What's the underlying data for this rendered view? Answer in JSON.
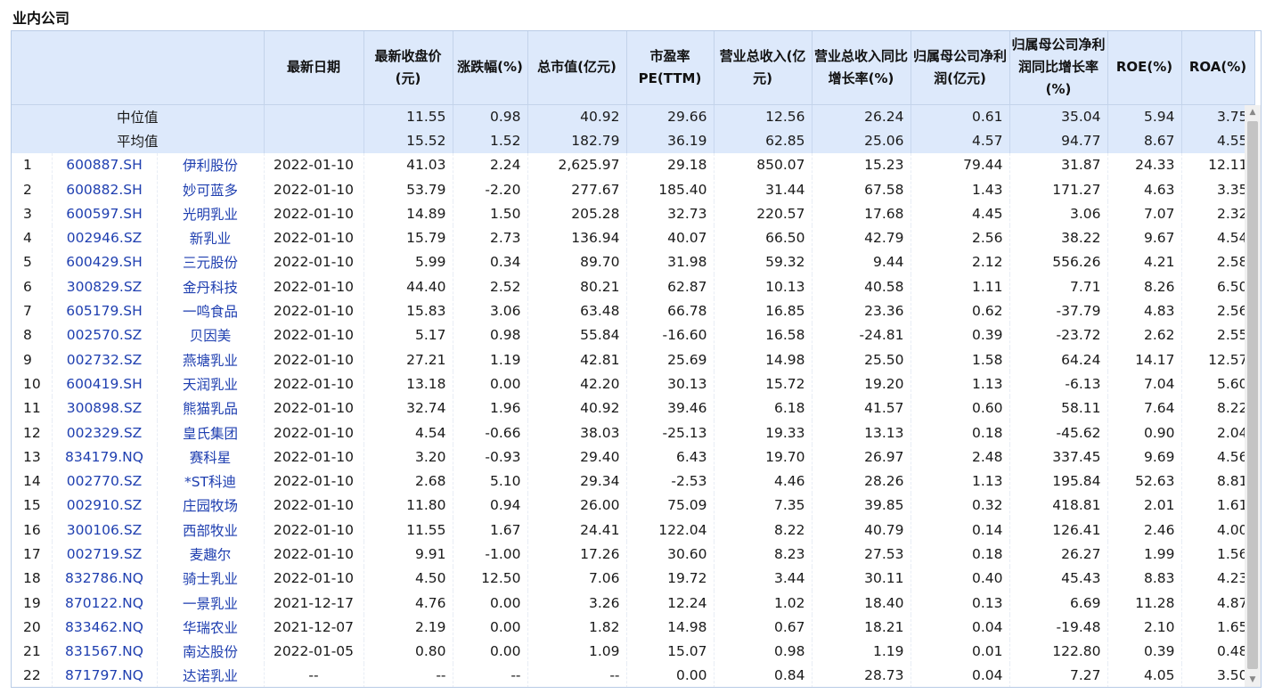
{
  "section_title": "业内公司",
  "headers": [
    "最新日期",
    "最新收盘价(元)",
    "涨跌幅(%)",
    "总市值(亿元)",
    "市盈率PE(TTM)",
    "营业总收入(亿元)",
    "营业总收入同比增长率(%)",
    "归属母公司净利润(亿元)",
    "归属母公司净利润同比增长率(%)",
    "ROE(%)",
    "ROA(%)"
  ],
  "stats": [
    {
      "label": "中位值",
      "values": [
        "11.55",
        "0.98",
        "40.92",
        "29.66",
        "12.56",
        "26.24",
        "0.61",
        "35.04",
        "5.94",
        "3.75"
      ]
    },
    {
      "label": "平均值",
      "values": [
        "15.52",
        "1.52",
        "182.79",
        "36.19",
        "62.85",
        "25.06",
        "4.57",
        "94.77",
        "8.67",
        "4.55"
      ]
    }
  ],
  "rows": [
    [
      "1",
      "600887.SH",
      "伊利股份",
      "2022-01-10",
      "41.03",
      "2.24",
      "2,625.97",
      "29.18",
      "850.07",
      "15.23",
      "79.44",
      "31.87",
      "24.33",
      "12.11"
    ],
    [
      "2",
      "600882.SH",
      "妙可蓝多",
      "2022-01-10",
      "53.79",
      "-2.20",
      "277.67",
      "185.40",
      "31.44",
      "67.58",
      "1.43",
      "171.27",
      "4.63",
      "3.35"
    ],
    [
      "3",
      "600597.SH",
      "光明乳业",
      "2022-01-10",
      "14.89",
      "1.50",
      "205.28",
      "32.73",
      "220.57",
      "17.68",
      "4.45",
      "3.06",
      "7.07",
      "2.32"
    ],
    [
      "4",
      "002946.SZ",
      "新乳业",
      "2022-01-10",
      "15.79",
      "2.73",
      "136.94",
      "40.07",
      "66.50",
      "42.79",
      "2.56",
      "38.22",
      "9.67",
      "4.54"
    ],
    [
      "5",
      "600429.SH",
      "三元股份",
      "2022-01-10",
      "5.99",
      "0.34",
      "89.70",
      "31.98",
      "59.32",
      "9.44",
      "2.12",
      "556.26",
      "4.21",
      "2.58"
    ],
    [
      "6",
      "300829.SZ",
      "金丹科技",
      "2022-01-10",
      "44.40",
      "2.52",
      "80.21",
      "62.87",
      "10.13",
      "40.58",
      "1.11",
      "7.71",
      "8.26",
      "6.50"
    ],
    [
      "7",
      "605179.SH",
      "一鸣食品",
      "2022-01-10",
      "15.83",
      "3.06",
      "63.48",
      "66.78",
      "16.85",
      "23.36",
      "0.62",
      "-37.79",
      "4.83",
      "2.56"
    ],
    [
      "8",
      "002570.SZ",
      "贝因美",
      "2022-01-10",
      "5.17",
      "0.98",
      "55.84",
      "-16.60",
      "16.58",
      "-24.81",
      "0.39",
      "-23.72",
      "2.62",
      "2.55"
    ],
    [
      "9",
      "002732.SZ",
      "燕塘乳业",
      "2022-01-10",
      "27.21",
      "1.19",
      "42.81",
      "25.69",
      "14.98",
      "25.50",
      "1.58",
      "64.24",
      "14.17",
      "12.57"
    ],
    [
      "10",
      "600419.SH",
      "天润乳业",
      "2022-01-10",
      "13.18",
      "0.00",
      "42.20",
      "30.13",
      "15.72",
      "19.20",
      "1.13",
      "-6.13",
      "7.04",
      "5.60"
    ],
    [
      "11",
      "300898.SZ",
      "熊猫乳品",
      "2022-01-10",
      "32.74",
      "1.96",
      "40.92",
      "39.46",
      "6.18",
      "41.57",
      "0.60",
      "58.11",
      "7.64",
      "8.22"
    ],
    [
      "12",
      "002329.SZ",
      "皇氏集团",
      "2022-01-10",
      "4.54",
      "-0.66",
      "38.03",
      "-25.13",
      "19.33",
      "13.13",
      "0.18",
      "-45.62",
      "0.90",
      "2.04"
    ],
    [
      "13",
      "834179.NQ",
      "赛科星",
      "2022-01-10",
      "3.20",
      "-0.93",
      "29.40",
      "6.43",
      "19.70",
      "26.97",
      "2.48",
      "337.45",
      "9.69",
      "4.56"
    ],
    [
      "14",
      "002770.SZ",
      "*ST科迪",
      "2022-01-10",
      "2.68",
      "5.10",
      "29.34",
      "-2.53",
      "4.46",
      "28.26",
      "1.13",
      "195.84",
      "52.63",
      "8.81"
    ],
    [
      "15",
      "002910.SZ",
      "庄园牧场",
      "2022-01-10",
      "11.80",
      "0.94",
      "26.00",
      "75.09",
      "7.35",
      "39.85",
      "0.32",
      "418.81",
      "2.01",
      "1.61"
    ],
    [
      "16",
      "300106.SZ",
      "西部牧业",
      "2022-01-10",
      "11.55",
      "1.67",
      "24.41",
      "122.04",
      "8.22",
      "40.79",
      "0.14",
      "126.41",
      "2.46",
      "4.00"
    ],
    [
      "17",
      "002719.SZ",
      "麦趣尔",
      "2022-01-10",
      "9.91",
      "-1.00",
      "17.26",
      "30.60",
      "8.23",
      "27.53",
      "0.18",
      "26.27",
      "1.99",
      "1.56"
    ],
    [
      "18",
      "832786.NQ",
      "骑士乳业",
      "2022-01-10",
      "4.50",
      "12.50",
      "7.06",
      "19.72",
      "3.44",
      "30.11",
      "0.40",
      "45.43",
      "8.83",
      "4.23"
    ],
    [
      "19",
      "870122.NQ",
      "一景乳业",
      "2021-12-17",
      "4.76",
      "0.00",
      "3.26",
      "12.24",
      "1.02",
      "18.40",
      "0.13",
      "6.69",
      "11.28",
      "4.87"
    ],
    [
      "20",
      "833462.NQ",
      "华瑞农业",
      "2021-12-07",
      "2.19",
      "0.00",
      "1.82",
      "14.98",
      "0.67",
      "18.21",
      "0.04",
      "-19.48",
      "2.10",
      "1.65"
    ],
    [
      "21",
      "831567.NQ",
      "南达股份",
      "2022-01-05",
      "0.80",
      "0.00",
      "1.09",
      "15.07",
      "0.98",
      "1.19",
      "0.01",
      "122.80",
      "0.39",
      "0.48"
    ],
    [
      "22",
      "871797.NQ",
      "达诺乳业",
      "--",
      "--",
      "--",
      "--",
      "0.00",
      "0.84",
      "28.73",
      "0.04",
      "7.27",
      "4.05",
      "3.50"
    ]
  ],
  "scrollbar": {
    "up_icon": "triangle-up-icon",
    "down_icon": "triangle-down-icon"
  },
  "colors": {
    "header_bg": "#dde9fb",
    "link": "#1f3fb0",
    "border": "#b8cbe6"
  }
}
